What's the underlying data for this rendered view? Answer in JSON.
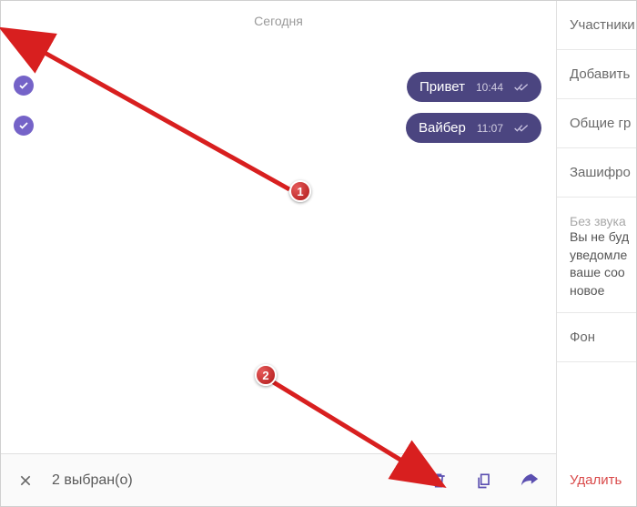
{
  "header": {
    "date_label": "Сегодня"
  },
  "messages": [
    {
      "text": "Привет",
      "time": "10:44"
    },
    {
      "text": "Вайбер",
      "time": "11:07"
    }
  ],
  "selection": {
    "count_label": "2 выбран(о)"
  },
  "sidebar": {
    "participants": "Участники",
    "add": "Добавить",
    "common_groups": "Общие гр",
    "encrypted": "Зашифро",
    "no_sound_header": "Без звука",
    "no_sound_body_l1": "Вы не буд",
    "no_sound_body_l2": "уведомле",
    "no_sound_body_l3": "ваше соо",
    "no_sound_body_l4": "новое",
    "background": "Фон",
    "delete": "Удалить"
  },
  "annotations": {
    "badge1": "1",
    "badge2": "2"
  },
  "colors": {
    "accent": "#5b4fb0",
    "msg_bg": "#4b4580",
    "check_bg": "#7563c8",
    "danger": "#d94a4a"
  }
}
